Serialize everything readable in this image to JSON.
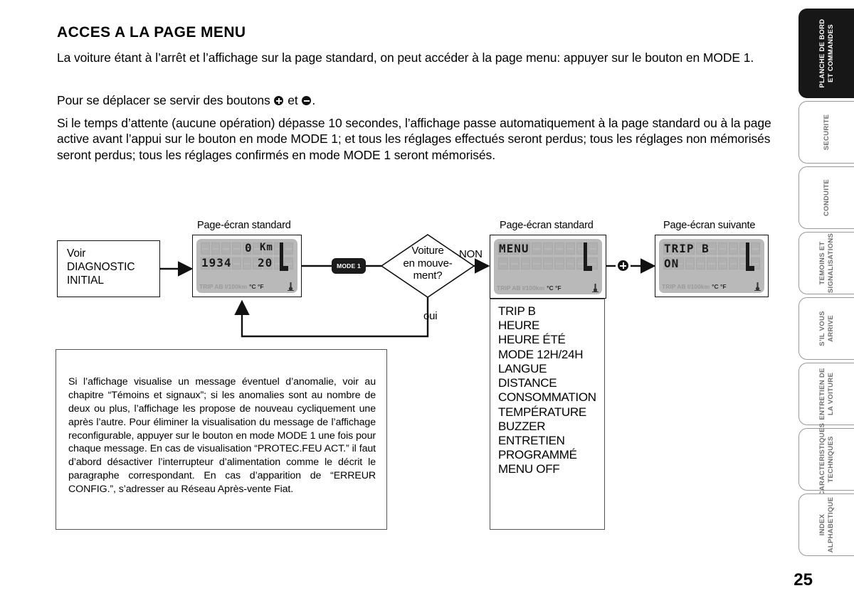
{
  "heading": "ACCES A LA PAGE MENU",
  "paragraphs": {
    "p1": "La voiture étant à l’arrêt et l’affichage sur la page standard, on peut accéder à la page menu: appuyer sur le bouton en MODE 1.",
    "p2_before": "Pour se déplacer se servir des boutons",
    "p2_mid": "et",
    "p2_after": ".",
    "p3": "Si le temps d’attente (aucune opération) dépasse 10 secondes, l’affichage passe automatiquement à la page standard ou à la page active avant l’appui sur le bouton en mode MODE 1; et tous les réglages effectués seront perdus; tous les réglages non mémorisés seront perdus; tous les réglages confirmés en mode MODE 1 seront mémorisés."
  },
  "flow": {
    "captions": {
      "standard_left": "Page-écran standard",
      "standard_middle": "Page-écran standard",
      "next": "Page-écran suivante"
    },
    "start_box": {
      "line1": "Voir",
      "line2": "DIAGNOSTIC",
      "line3": "INITIAL"
    },
    "lcd_left": {
      "value_km": "0",
      "unit_km": "Km",
      "clock": "1934",
      "temp": "20",
      "bottom_bar_text": "TRIP AB l/100km",
      "bottom_bar_units": "°C  °F"
    },
    "lcd_menu": {
      "line1": "MENU",
      "bottom_bar_text": "TRIP AB l/100km",
      "bottom_bar_units": "°C °F"
    },
    "lcd_next": {
      "line1": "TRIP B",
      "line2": "ON",
      "bottom_bar_text": "TRIP AB l/100km",
      "bottom_bar_units": "°C °F"
    },
    "mode_button_label": "MODE 1",
    "decision": {
      "line1": "Voiture",
      "line2": "en mouve-",
      "line3": "ment?"
    },
    "edge_no": "NON",
    "edge_yes": "oui",
    "plus_button_name": "plus"
  },
  "menu_items": [
    "TRIP B",
    "HEURE",
    "HEURE ÉTÉ",
    "MODE 12H/24H",
    "LANGUE",
    "DISTANCE",
    "CONSOMMATION",
    "TEMPÉRATURE",
    "BUZZER",
    "ENTRETIEN",
    "PROGRAMMÉ",
    "MENU OFF"
  ],
  "note": "Si l’affichage visualise un message éventuel d’anomalie, voir au chapitre “Témoins et signaux”; si les anomalies sont au nombre de deux ou plus, l’affichage les propose de nouveau cycliquement une après l’autre. Pour éliminer la visualisation du message de l’affichage reconfigurable, appuyer sur le bouton en mode MODE 1 une fois pour chaque message. En cas de visualisation “PROTEC.FEU ACT.” il faut d’abord désactiver l’interrupteur d’alimentation comme le décrit le paragraphe correspondant. En cas d’apparition de “ERREUR CONFIG.”, s’adresser au Réseau Après-vente Fiat.",
  "tabs": [
    {
      "label": "PLANCHE DE BORD\nET COMMANDES",
      "active": true
    },
    {
      "label": "SECURITE",
      "active": false
    },
    {
      "label": "CONDUITE",
      "active": false
    },
    {
      "label": "TEMOINS ET\nSIGNALISATIONS",
      "active": false
    },
    {
      "label": "S’IL VOUS\nARRIVE",
      "active": false
    },
    {
      "label": "ENTRETIEN DE\nLA VOITURE",
      "active": false
    },
    {
      "label": "CARACTERISTIQUES\nTECHNIQUES",
      "active": false
    },
    {
      "label": "INDEX\nALPHABETIQUE",
      "active": false
    }
  ],
  "page_number": "25",
  "colors": {
    "ink": "#111111",
    "lcd_bg": "#b9b9b9",
    "lcd_cell": "#b0b0b0",
    "tab_border": "#9a9a9a",
    "tab_active_bg": "#171717"
  }
}
